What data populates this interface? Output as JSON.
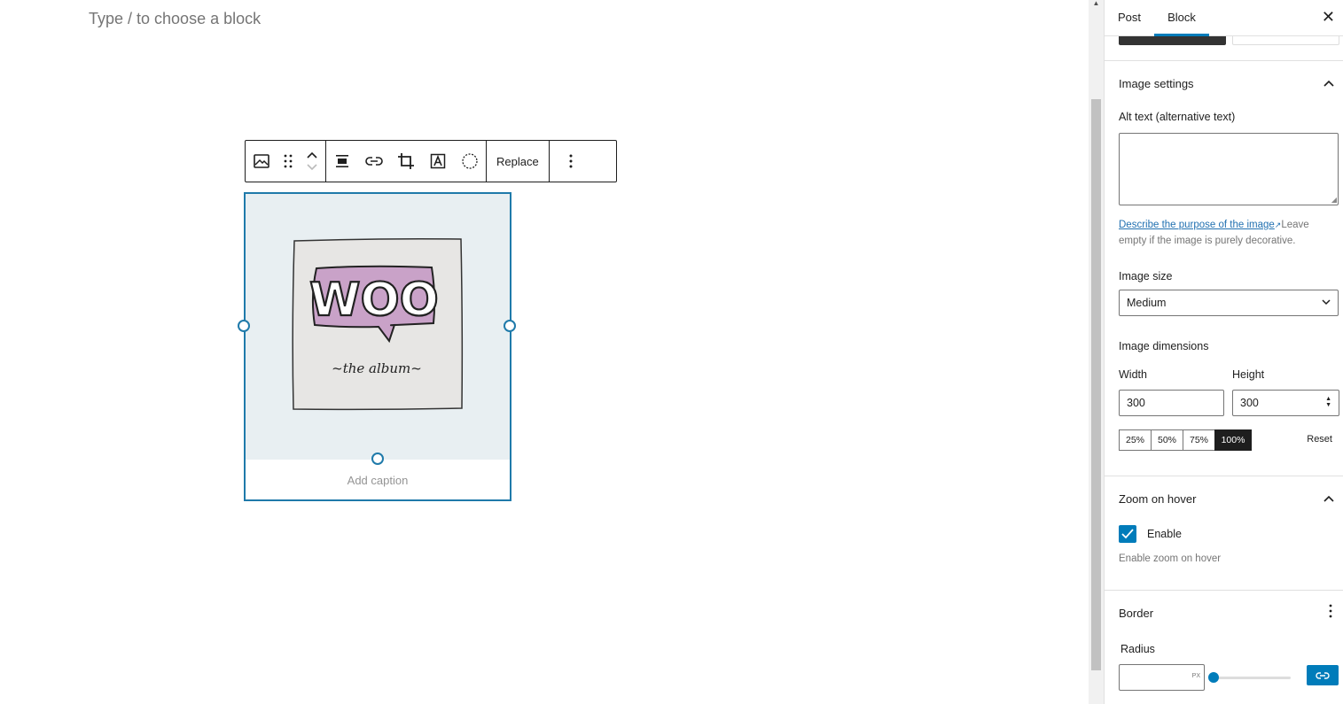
{
  "editor": {
    "placeholder": "Type / to choose a block",
    "toolbar": {
      "replace_label": "Replace",
      "icons": [
        "image-icon",
        "drag-handle-icon",
        "move-up-icon",
        "move-down-icon",
        "align-icon",
        "link-icon",
        "crop-icon",
        "text-overlay-icon",
        "duotone-icon",
        "more-options-icon"
      ]
    },
    "image": {
      "logo_word": "WOO",
      "tagline": "~the  album~",
      "caption_placeholder": "Add caption"
    }
  },
  "sidebar": {
    "tabs": [
      {
        "label": "Post",
        "active": false
      },
      {
        "label": "Block",
        "active": true
      }
    ],
    "close_label": "✕",
    "image_settings": {
      "title": "Image settings",
      "alt_label": "Alt text (alternative text)",
      "alt_value": "",
      "alt_help_link": "Describe the purpose of the image",
      "alt_help_text": "Leave empty if the image is purely decorative.",
      "size_label": "Image size",
      "size_value": "Medium",
      "dimensions_label": "Image dimensions",
      "width_label": "Width",
      "width_value": "300",
      "height_label": "Height",
      "height_value": "300",
      "percent_options": [
        "25%",
        "50%",
        "75%",
        "100%"
      ],
      "percent_selected": "100%",
      "reset_label": "Reset"
    },
    "zoom": {
      "title": "Zoom on hover",
      "enable_label": "Enable",
      "enabled": true,
      "help": "Enable zoom on hover"
    },
    "border": {
      "title": "Border",
      "radius_label": "Radius",
      "radius_value": "",
      "unit": "PX",
      "slider_value": 0
    }
  },
  "colors": {
    "accent": "#007cba",
    "selection": "#1f7aaa",
    "logo_bubble": "#c9a2c8"
  }
}
